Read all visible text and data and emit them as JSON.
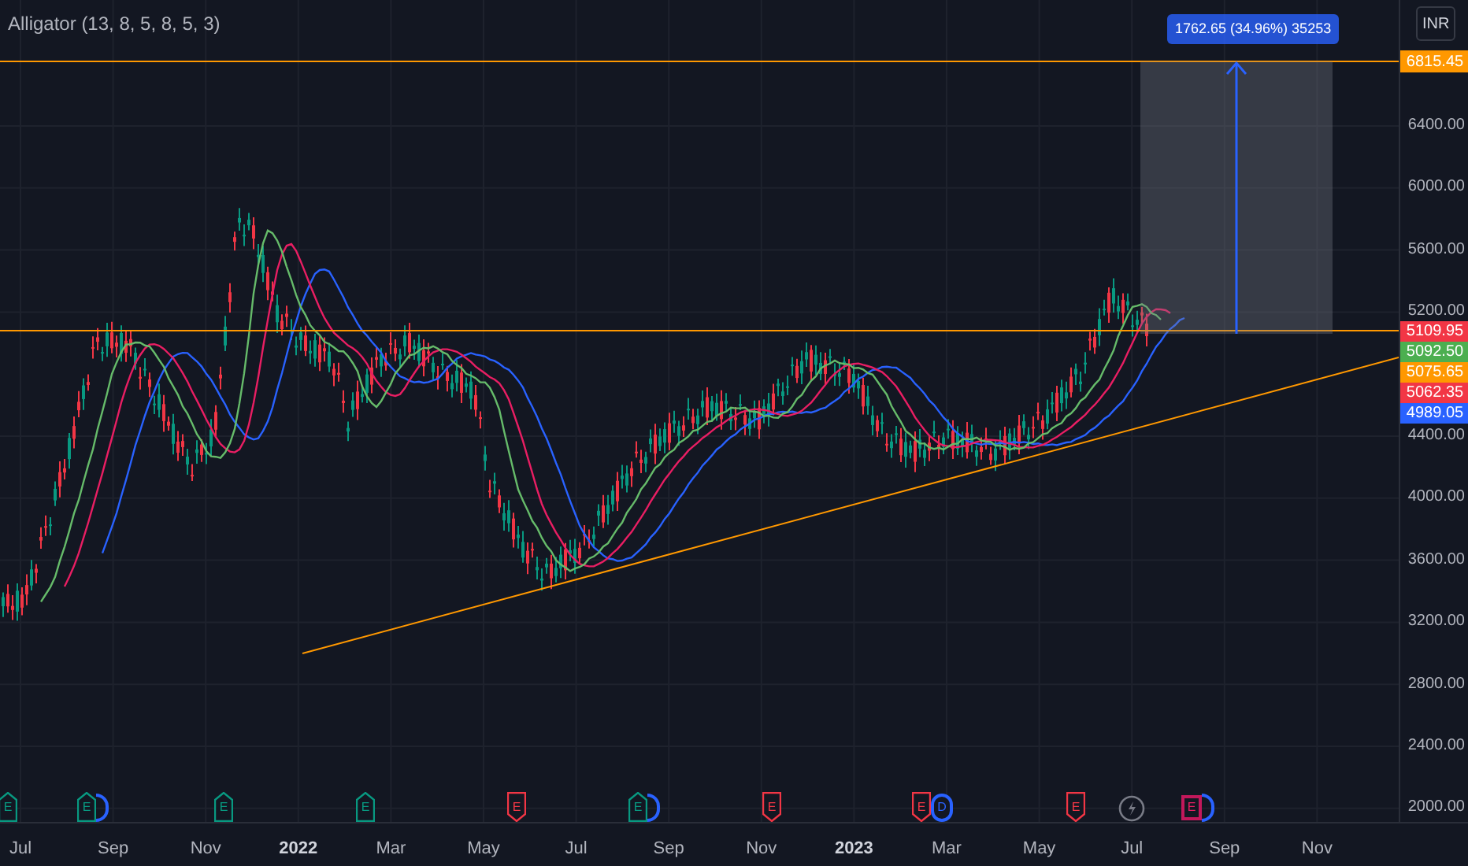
{
  "indicator": {
    "label": "Alligator (13, 8, 5, 8, 5, 3)"
  },
  "currency": "INR",
  "price_ticks": [
    "6400.00",
    "6000.00",
    "5600.00",
    "5200.00",
    "4400.00",
    "4000.00",
    "3600.00",
    "3200.00",
    "2800.00",
    "2400.00",
    "2000.00"
  ],
  "time_ticks": [
    {
      "label": "Jul",
      "year": false
    },
    {
      "label": "Sep",
      "year": false
    },
    {
      "label": "Nov",
      "year": false
    },
    {
      "label": "2022",
      "year": true
    },
    {
      "label": "Mar",
      "year": false
    },
    {
      "label": "May",
      "year": false
    },
    {
      "label": "Jul",
      "year": false
    },
    {
      "label": "Sep",
      "year": false
    },
    {
      "label": "Nov",
      "year": false
    },
    {
      "label": "2023",
      "year": true
    },
    {
      "label": "Mar",
      "year": false
    },
    {
      "label": "May",
      "year": false
    },
    {
      "label": "Jul",
      "year": false
    },
    {
      "label": "Sep",
      "year": false
    },
    {
      "label": "Nov",
      "year": false
    }
  ],
  "price_labels": [
    {
      "value": "6815.45",
      "color": "#ff9800"
    },
    {
      "value": "5109.95",
      "color": "#f23645"
    },
    {
      "value": "5092.50",
      "color": "#4caf50"
    },
    {
      "value": "5075.65",
      "color": "#ff9800"
    },
    {
      "value": "5062.35",
      "color": "#f23645"
    },
    {
      "value": "4989.05",
      "color": "#2962ff"
    }
  ],
  "measure": {
    "label": "1762.65 (34.96%) 35253"
  },
  "events": [
    {
      "kind": "up",
      "letter": "E",
      "dividend_behind": false
    },
    {
      "kind": "up",
      "letter": "E",
      "dividend_behind": true
    },
    {
      "kind": "up",
      "letter": "E",
      "dividend_behind": false
    },
    {
      "kind": "up",
      "letter": "E",
      "dividend_behind": false
    },
    {
      "kind": "down",
      "letter": "E",
      "dividend_behind": false
    },
    {
      "kind": "up",
      "letter": "E",
      "dividend_behind": true
    },
    {
      "kind": "down",
      "letter": "E",
      "dividend_behind": false
    },
    {
      "kind": "down",
      "letter": "E",
      "dividend_behind": false
    },
    {
      "kind": "dividend",
      "letter": "D",
      "dividend_behind": false
    },
    {
      "kind": "down",
      "letter": "E",
      "dividend_behind": false
    },
    {
      "kind": "flash",
      "dividend_behind": false
    },
    {
      "kind": "upcoming",
      "letter": "E",
      "dividend_behind": true
    }
  ]
}
